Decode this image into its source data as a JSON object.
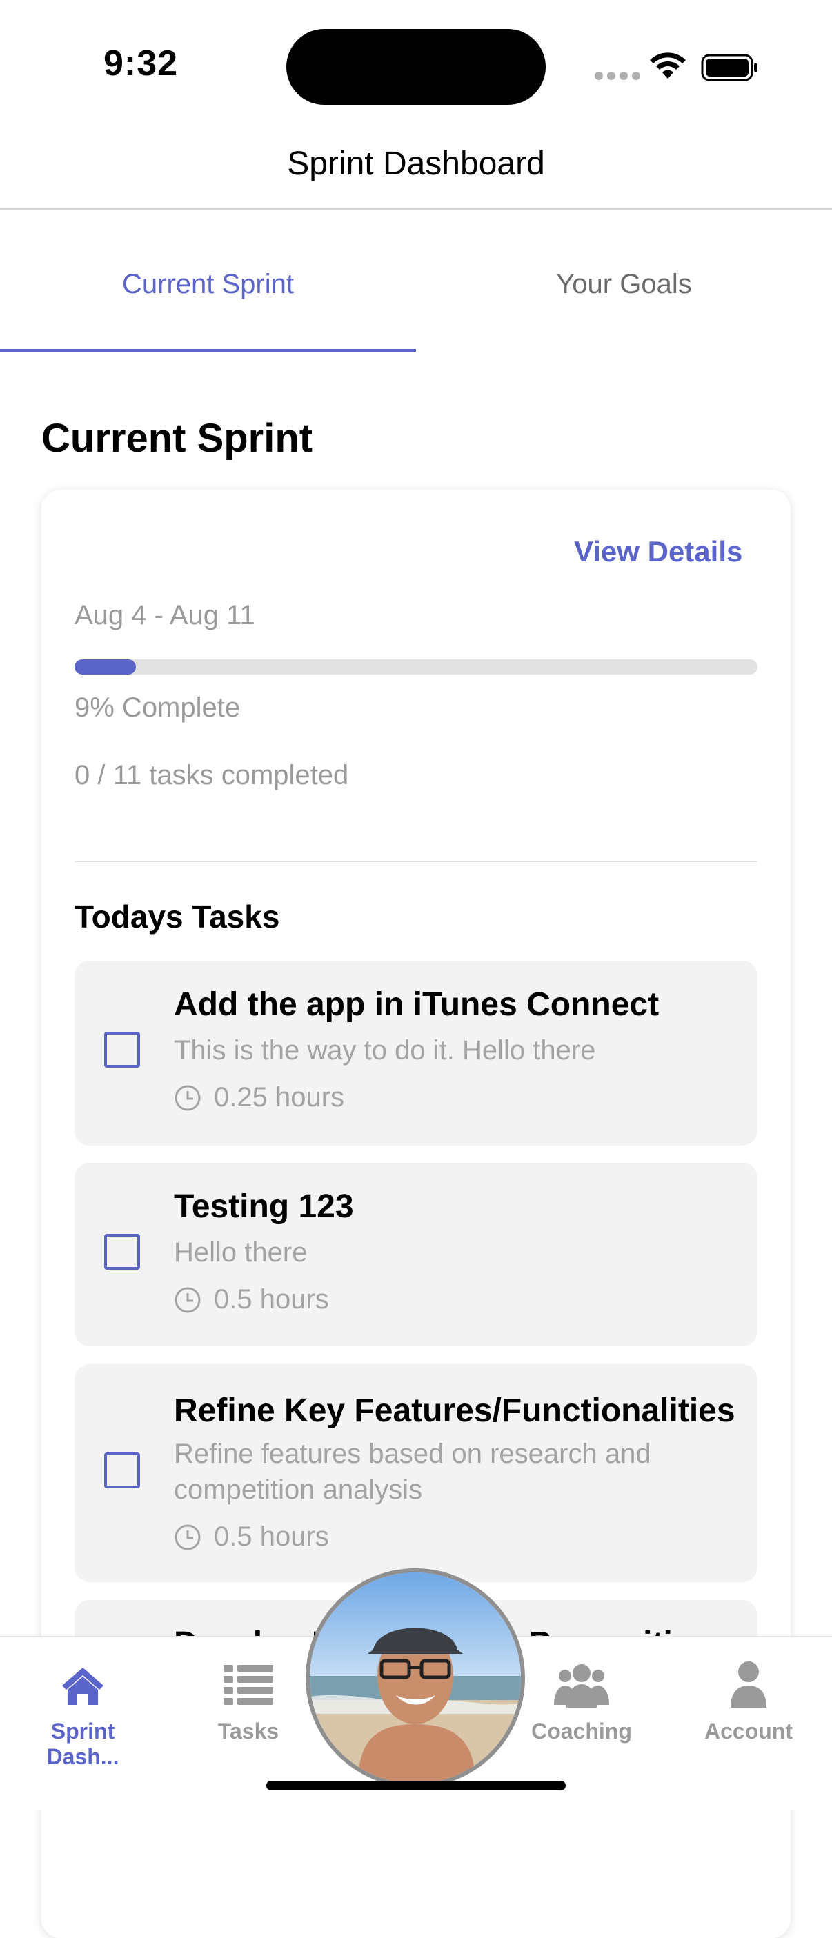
{
  "status_bar": {
    "time": "9:32"
  },
  "nav": {
    "title": "Sprint Dashboard"
  },
  "tabs": [
    {
      "label": "Current Sprint",
      "active": true
    },
    {
      "label": "Your Goals",
      "active": false
    }
  ],
  "section": {
    "title": "Current Sprint"
  },
  "sprint": {
    "view_details": "View Details",
    "date_range": "Aug 4 - Aug 11",
    "progress_fraction": 0.09,
    "percent_label": "9% Complete",
    "tasks_completed": "0 / 11 tasks completed"
  },
  "todays_tasks": {
    "heading": "Todays Tasks",
    "items": [
      {
        "title": "Add the app in iTunes Connect",
        "description": "This is the way to do it. Hello there",
        "hours": "0.25 hours",
        "checked": false
      },
      {
        "title": "Testing 123",
        "description": "Hello there",
        "hours": "0.5 hours",
        "checked": false
      },
      {
        "title": "Refine Key Features/Functionalities",
        "description": "Refine features based on research and competition analysis",
        "hours": "0.5 hours",
        "checked": false
      },
      {
        "title": "Develop Unique Value Proposition",
        "description": "",
        "hours": "",
        "checked": false
      }
    ]
  },
  "tab_bar": {
    "items": [
      {
        "label": "Sprint Dash...",
        "icon": "house-icon",
        "active": true
      },
      {
        "label": "Tasks",
        "icon": "list-icon",
        "active": false
      },
      {
        "label": "Coaching",
        "icon": "people-icon",
        "active": false
      },
      {
        "label": "Account",
        "icon": "person-icon",
        "active": false
      }
    ],
    "center_avatar": "avatar-photo"
  },
  "colors": {
    "accent": "#5b64c9",
    "muted_text": "#9a9a9a",
    "task_bg": "#f3f3f3"
  }
}
